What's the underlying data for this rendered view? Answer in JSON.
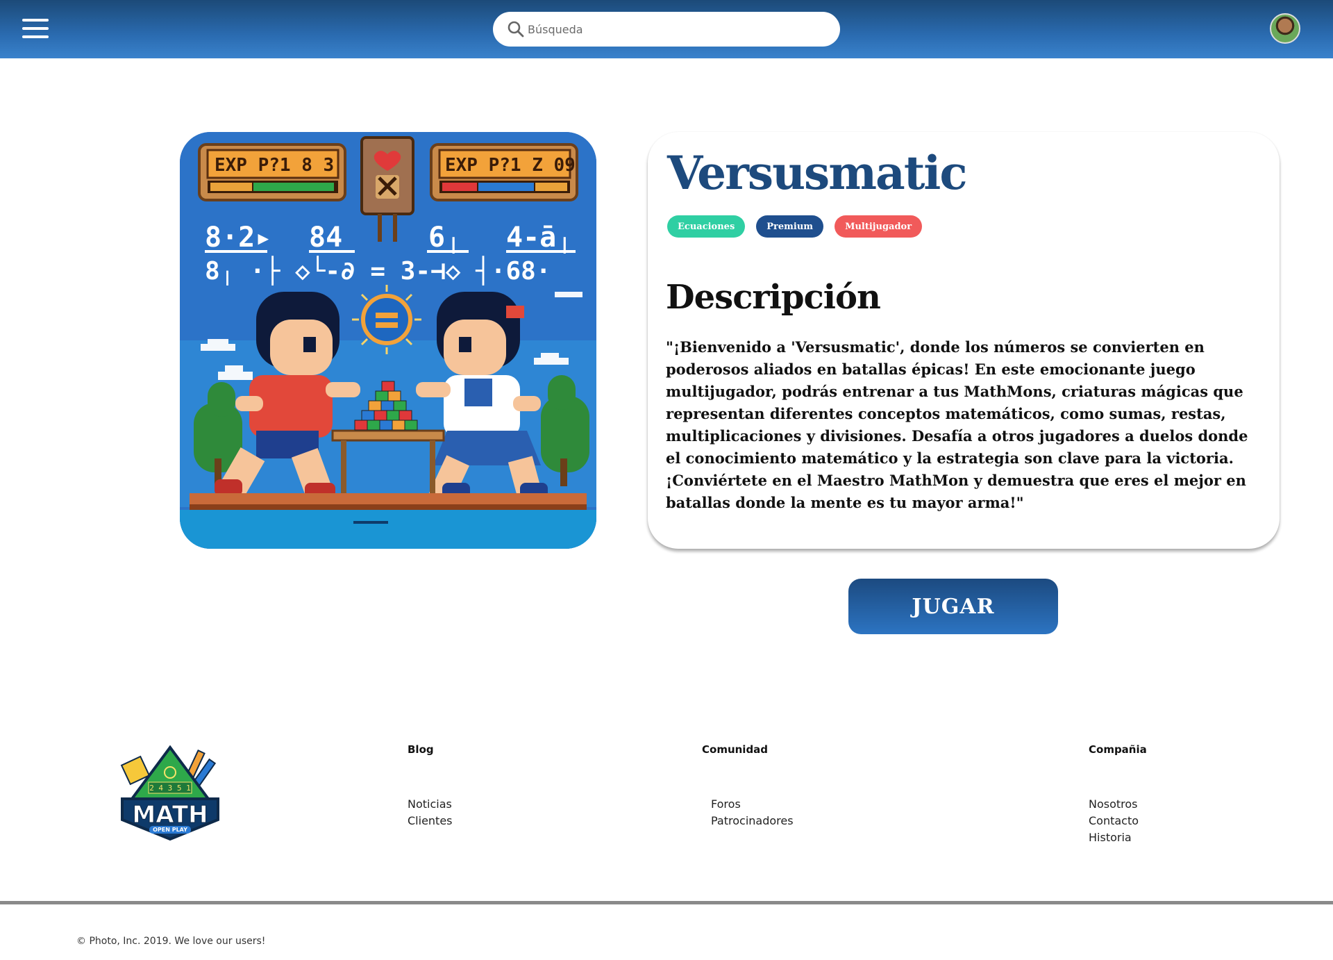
{
  "header": {
    "search_placeholder": "Búsqueda"
  },
  "game": {
    "title": "Versusmatic",
    "tags": [
      "Ecuaciones",
      "Premium",
      "Multijugador"
    ],
    "description_heading": "Descripción",
    "description": "\"¡Bienvenido a 'Versusmatic', donde los números se convierten en poderosos aliados en batallas épicas! En este emocionante juego multijugador, podrás entrenar a tus MathMons, criaturas mágicas que representan diferentes conceptos matemáticos, como sumas, restas, multiplicaciones y divisiones. Desafía a otros jugadores a duelos donde el conocimiento matemático y la estrategia son clave para la victoria. ¡Conviértete en el Maestro MathMon y demuestra que eres el mejor en batallas donde la mente es tu mayor arma!\"",
    "play_label": "JUGAR"
  },
  "art": {
    "left_panel": "EXP P?1 8 3",
    "right_panel": "EXP P?1 Z 09",
    "eq_row1_left": "8·2▸",
    "eq_row1_mid": "84",
    "eq_row1_r1": "6╷",
    "eq_row1_r2": "4-ā╷",
    "eq_row2": "8╷ ·├ ◇└-∂  =  3-⊣◇ ┤·68·"
  },
  "logo": {
    "numbers": "2 4 3 5 1",
    "text": "MATH",
    "subtitle": "OPEN PLAY"
  },
  "footer": {
    "columns": [
      {
        "heading": "Blog",
        "links": [
          "Noticias",
          "Clientes"
        ]
      },
      {
        "heading": "Comunidad",
        "links": [
          "Foros",
          "Patrocinadores"
        ]
      },
      {
        "heading": "Compañia",
        "links": [
          "Nosotros",
          "Contacto",
          "Historia"
        ]
      }
    ],
    "copyright": "© Photo, Inc. 2019. We love our users!"
  },
  "colors": {
    "header": "#2a6bb0",
    "title": "#1d4a7d",
    "tag_ecuaciones": "#2fcfa3",
    "tag_premium": "#1f4f8e",
    "tag_multijugador": "#f15a5a"
  }
}
